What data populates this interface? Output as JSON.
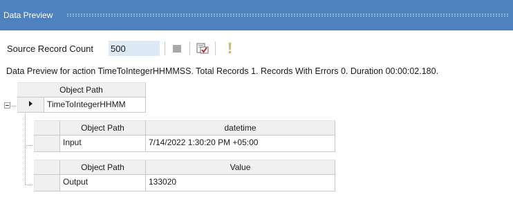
{
  "window": {
    "title": "Data Preview"
  },
  "toolbar": {
    "source_record_count_label": "Source Record Count",
    "source_record_count_value": "500",
    "stop_icon": "stop-icon",
    "preview_icon": "preview-check-icon",
    "info_icon": "exclamation-icon"
  },
  "status": {
    "message": "Data Preview for action TimeToIntegerHHMMSS. Total Records 1. Records With Errors 0. Duration 00:00:02.180."
  },
  "grid": {
    "root": {
      "header": "Object Path",
      "value": "TimeToIntegerHHMM"
    },
    "input_table": {
      "col1_header": "Object Path",
      "col2_header": "datetime",
      "col1_value": "Input",
      "col2_value": "7/14/2022 1:30:20 PM +05:00"
    },
    "output_table": {
      "col1_header": "Object Path",
      "col2_header": "Value",
      "col1_value": "Output",
      "col2_value": "133020"
    }
  },
  "colors": {
    "title_bar": "#4d82bf",
    "count_field": "#dde9f5",
    "header_bg": "#f0f0f0"
  }
}
